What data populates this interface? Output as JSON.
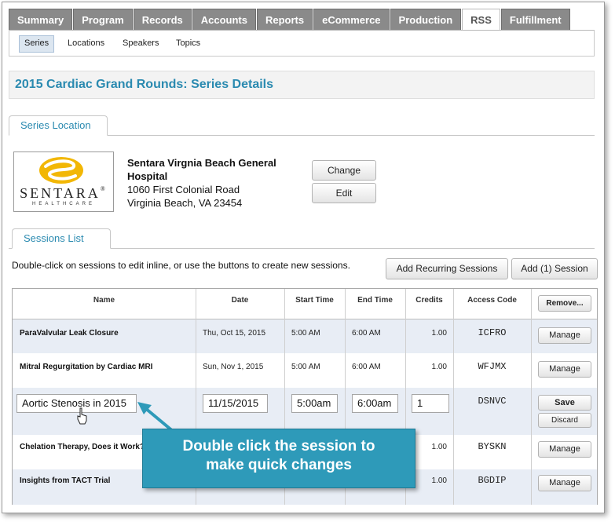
{
  "nav": {
    "tabs": [
      "Summary",
      "Program",
      "Records",
      "Accounts",
      "Reports",
      "eCommerce",
      "Production",
      "RSS",
      "Fulfillment"
    ],
    "active_tab": "RSS",
    "subtabs": [
      "Series",
      "Locations",
      "Speakers",
      "Topics"
    ],
    "active_subtab": "Series"
  },
  "page_title": "2015 Cardiac Grand Rounds: Series Details",
  "location": {
    "tab_label": "Series Location",
    "logo_text": "SENTARA",
    "logo_sub": "HEALTHCARE",
    "logo_mark": "®",
    "name": "Sentara Virgnia Beach General Hospital",
    "address_line1": "1060 First Colonial Road",
    "address_line2": "Virginia Beach, VA 23454",
    "change_label": "Change",
    "edit_label": "Edit"
  },
  "sessions": {
    "tab_label": "Sessions List",
    "instructions": "Double-click on sessions to edit inline, or use the buttons to create new sessions.",
    "add_recurring_label": "Add Recurring Sessions",
    "add_session_label": "Add (1) Session",
    "columns": [
      "Name",
      "Date",
      "Start Time",
      "End Time",
      "Credits",
      "Access Code"
    ],
    "remove_label": "Remove...",
    "manage_label": "Manage",
    "rows": [
      {
        "name": "ParaValvular Leak Closure",
        "date": "Thu, Oct 15, 2015",
        "start": "5:00 AM",
        "end": "6:00 AM",
        "credits": "1.00",
        "code": "ICFRO"
      },
      {
        "name": "Mitral Regurgitation by Cardiac MRI",
        "date": "Sun, Nov 1, 2015",
        "start": "5:00 AM",
        "end": "6:00 AM",
        "credits": "1.00",
        "code": "WFJMX"
      },
      {
        "name": "Chelation Therapy, Does it Work?",
        "date": "",
        "start": "",
        "end": "",
        "credits": "1.00",
        "code": "BYSKN"
      },
      {
        "name": "Insights from TACT Trial",
        "date": "",
        "start": "",
        "end": "",
        "credits": "1.00",
        "code": "BGDIP"
      }
    ],
    "edit_row": {
      "name": "Aortic Stenosis in 2015",
      "date": "11/15/2015",
      "start": "5:00am",
      "end": "6:00am",
      "credits": "1",
      "code": "DSNVC",
      "save_label": "Save",
      "discard_label": "Discard"
    }
  },
  "callout": {
    "line1": "Double click the session to",
    "line2": "make quick changes"
  },
  "colors": {
    "accent": "#2a8ab0",
    "callout": "#2e9ab9",
    "row_shaded": "#e8edf5",
    "tab_gray": "#8a8a8a"
  }
}
